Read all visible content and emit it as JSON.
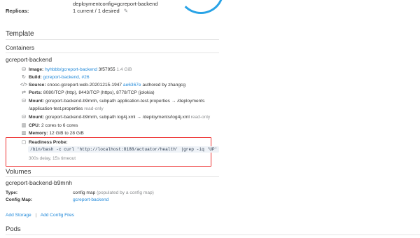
{
  "header": {
    "deploymentconfig": "deploymentconfig=gcreport-backend",
    "replicas_label": "Replicas:",
    "replicas_value": "1 current / 1 desired"
  },
  "template": {
    "title": "Template",
    "containers_title": "Containers",
    "container_name": "gcreport-backend",
    "rows": [
      {
        "icon": "image-icon",
        "label": "Image:",
        "link": "hyhbbb/gcreport-backend",
        "value": "3f57955",
        "muted": "1.4 GiB"
      },
      {
        "icon": "build-icon",
        "label": "Build:",
        "link": "gcreport-backend, #26",
        "value": "",
        "muted": ""
      },
      {
        "icon": "source-icon",
        "label": "Source:",
        "value": "cnooc-gcreport-web-20201215-1947",
        "link": "ae6367e",
        "value2": "authored by zhangcg"
      },
      {
        "icon": "ports-icon",
        "label": "Ports:",
        "value": "8080/TCP (http), 8443/TCP (https), 8778/TCP (jolokia)"
      },
      {
        "icon": "mount-icon",
        "label": "Mount:",
        "value": "gcreport-backend-b9mnh, subpath application-test.properties → /deployments",
        "value_line2": "/application-test.properties",
        "muted": "read-only"
      },
      {
        "icon": "mount-icon",
        "label": "Mount:",
        "value": "gcreport-backend-b9mnh, subpath log4j.xml → /deployments/log4j.xml",
        "muted": "read-only"
      },
      {
        "icon": "cpu-icon",
        "label": "CPU:",
        "value": "2 cores to 6 cores"
      },
      {
        "icon": "memory-icon",
        "label": "Memory:",
        "value": "12 GiB to 28 GiB"
      }
    ],
    "probe": {
      "label": "Readiness Probe:",
      "command": "/bin/bash -c curl 'http://localhost:8188/actuator/health' |grep -iq 'UP'",
      "timing": "300s delay, 15s timeout"
    }
  },
  "volumes": {
    "title": "Volumes",
    "name": "gcreport-backend-b9mnh",
    "type_label": "Type:",
    "type_value": "config map",
    "type_note": "(populated by a config map)",
    "configmap_label": "Config Map:",
    "configmap_value": "gcreport-backend"
  },
  "actions": {
    "add_storage": "Add Storage",
    "separator": "|",
    "add_config_files": "Add Config Files"
  },
  "pods": {
    "title": "Pods"
  },
  "colors": {
    "link": "#1f88d9",
    "highlight": "#e33333",
    "ring": "#29a3e6"
  }
}
